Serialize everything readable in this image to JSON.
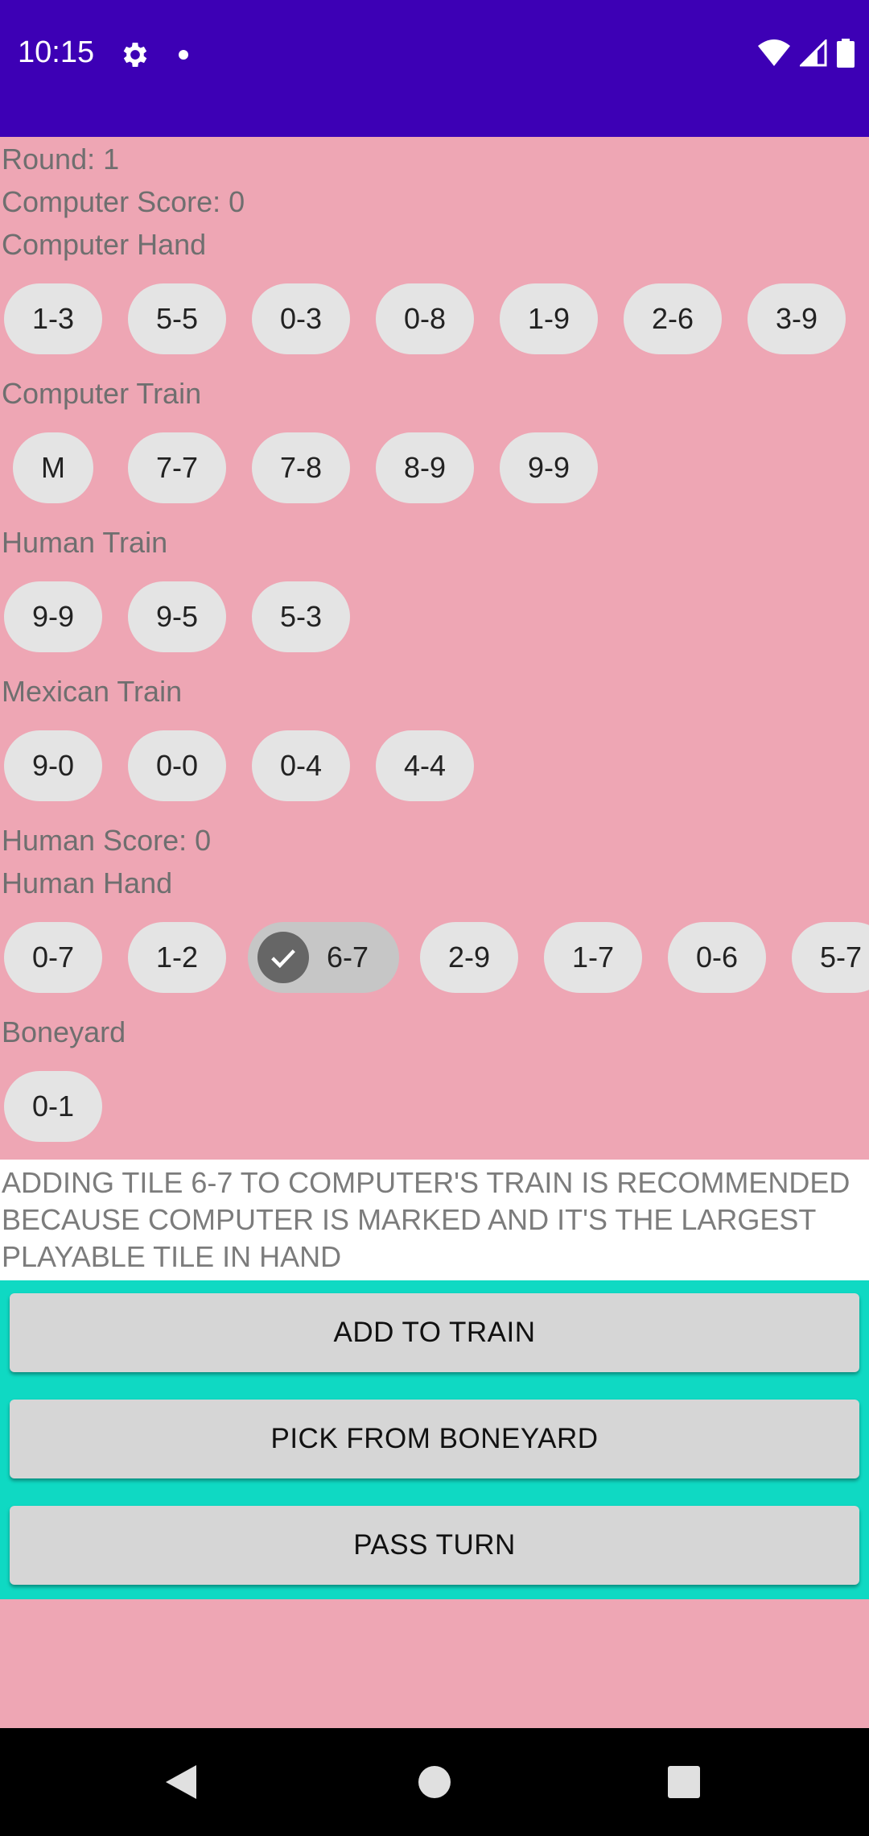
{
  "status": {
    "time": "10:15",
    "icons": [
      "gear-icon",
      "notification-dot-icon",
      "wifi-icon",
      "cell-signal-icon",
      "battery-icon"
    ]
  },
  "game": {
    "round": "Round: 1",
    "computer_score": "Computer Score: 0",
    "computer_hand_label": "Computer Hand",
    "computer_hand": [
      "1-3",
      "5-5",
      "0-3",
      "0-8",
      "1-9",
      "2-6",
      "3-9"
    ],
    "computer_train_label": "Computer Train",
    "computer_train": [
      "M",
      "7-7",
      "7-8",
      "8-9",
      "9-9"
    ],
    "human_train_label": "Human Train",
    "human_train": [
      "9-9",
      "9-5",
      "5-3"
    ],
    "mexican_train_label": "Mexican Train",
    "mexican_train": [
      "9-0",
      "0-0",
      "0-4",
      "4-4"
    ],
    "human_score": "Human Score: 0",
    "human_hand_label": "Human Hand",
    "human_hand": [
      "0-7",
      "1-2",
      "6-7",
      "2-9",
      "1-7",
      "0-6",
      "5-7"
    ],
    "human_hand_selected": "6-7",
    "boneyard_label": "Boneyard",
    "boneyard": [
      "0-1"
    ]
  },
  "message": {
    "line1": "ADDING TILE 6-7 TO COMPUTER'S TRAIN IS RECOMMENDED",
    "line2": "BECAUSE COMPUTER IS MARKED AND IT'S THE LARGEST",
    "line3": "PLAYABLE TILE IN HAND"
  },
  "actions": {
    "add_to_train": "ADD TO TRAIN",
    "pick_from_boneyard": "PICK FROM BONEYARD",
    "pass_turn": "PASS TURN"
  },
  "colors": {
    "status_bar": "#3d00b5",
    "background": "#eea6b4",
    "button_panel": "#0fd9c3",
    "chip": "#e4e4e4",
    "chip_selected": "#c6c6c6"
  }
}
